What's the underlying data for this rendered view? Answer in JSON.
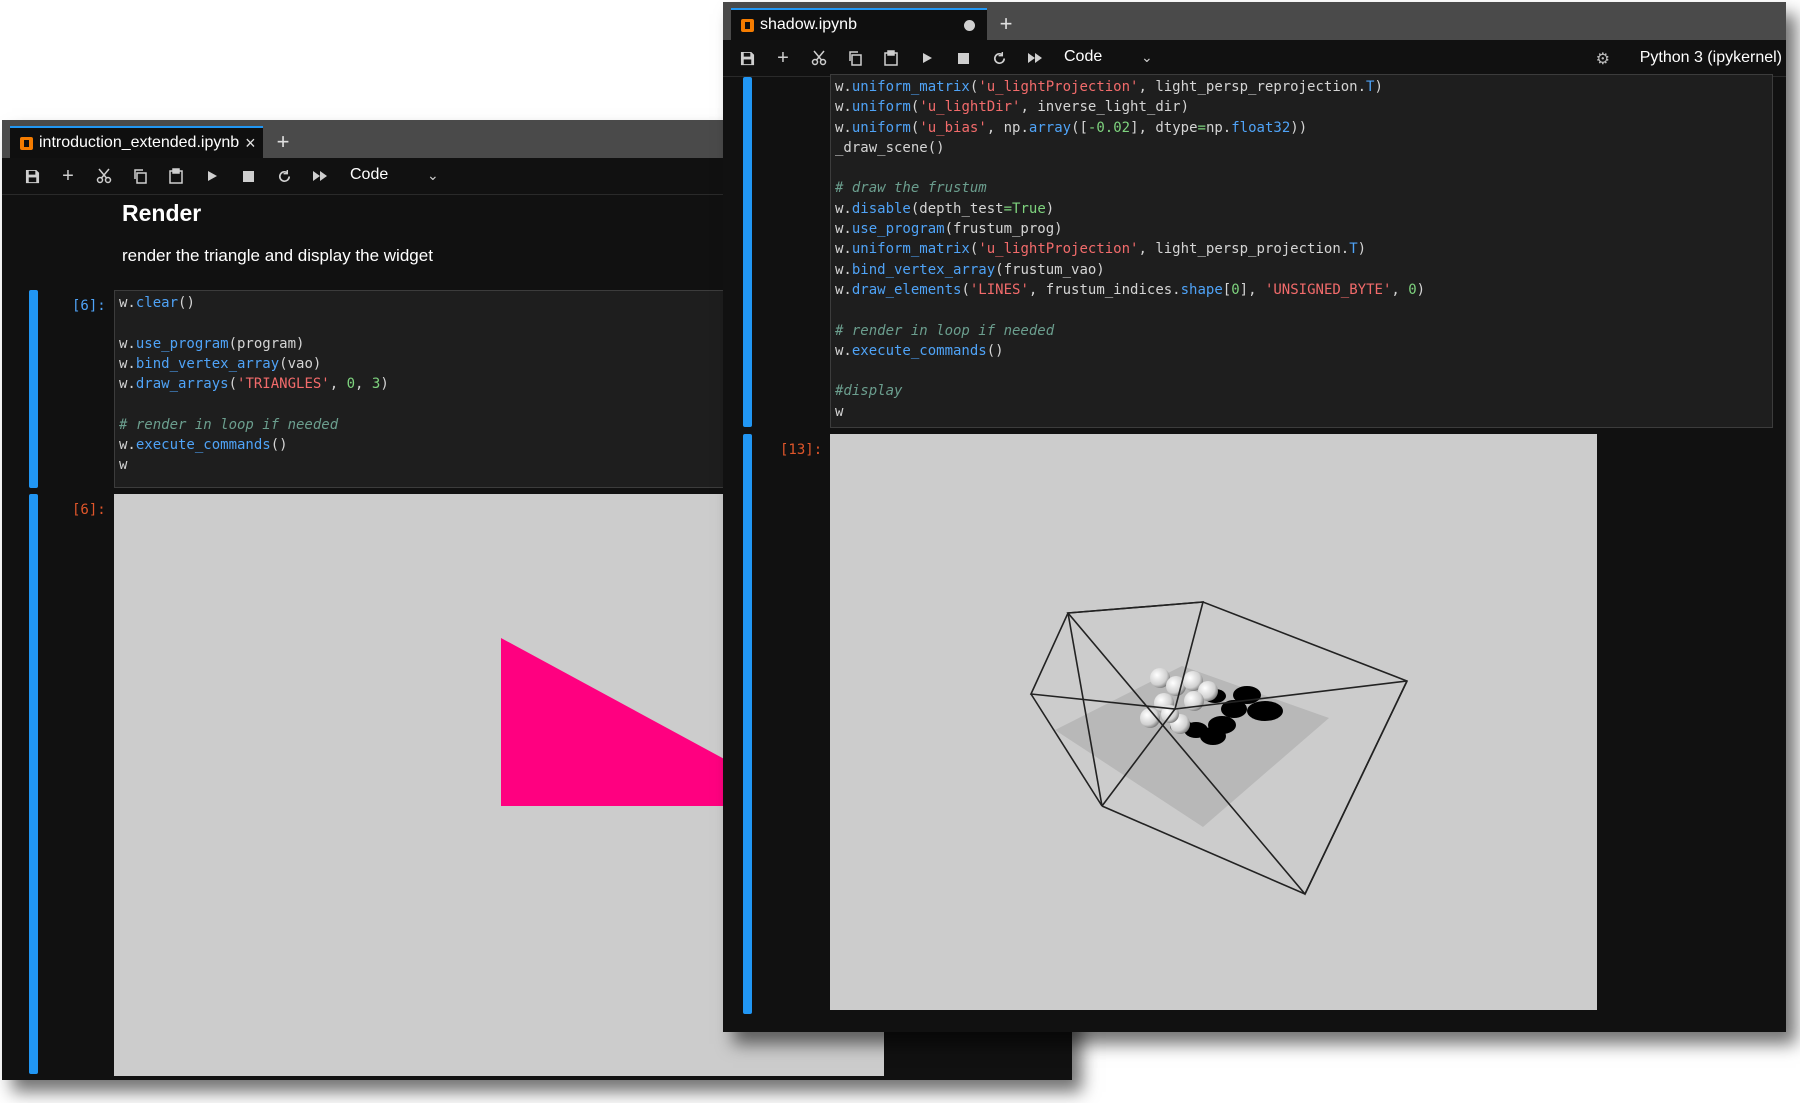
{
  "windowA": {
    "tab_label": "introduction_extended.ipynb",
    "tab_close": "×",
    "new_tab": "+",
    "toolbar": {
      "cell_type": "Code",
      "icons": [
        "save-icon",
        "add-cell-icon",
        "cut-icon",
        "copy-icon",
        "paste-icon",
        "run-icon",
        "stop-icon",
        "restart-icon",
        "fast-forward-icon"
      ]
    },
    "markdown": {
      "heading": "Render",
      "text": "render the triangle and display the widget"
    },
    "input_prompt": "[6]:",
    "output_prompt": "[6]:",
    "code_lines": [
      [
        [
          "w.",
          ""
        ],
        [
          "clear",
          "fn"
        ],
        [
          "()",
          ""
        ]
      ],
      [],
      [
        [
          "w.",
          ""
        ],
        [
          "use_program",
          "fn"
        ],
        [
          "(program)",
          ""
        ]
      ],
      [
        [
          "w.",
          ""
        ],
        [
          "bind_vertex_array",
          "fn"
        ],
        [
          "(vao)",
          ""
        ]
      ],
      [
        [
          "w.",
          ""
        ],
        [
          "draw_arrays",
          "fn"
        ],
        [
          "(",
          ""
        ],
        [
          "'TRIANGLES'",
          "str"
        ],
        [
          ", ",
          ""
        ],
        [
          "0",
          "num"
        ],
        [
          ", ",
          ""
        ],
        [
          "3",
          "num"
        ],
        [
          ")",
          ""
        ]
      ],
      [],
      [
        [
          "# render in loop if needed",
          "com"
        ]
      ],
      [
        [
          "w.",
          ""
        ],
        [
          "execute_commands",
          "fn"
        ],
        [
          "()",
          ""
        ]
      ],
      [
        [
          "w",
          ""
        ]
      ]
    ],
    "triangle_color": "#ff0080"
  },
  "windowB": {
    "tab_label": "shadow.ipynb",
    "new_tab": "+",
    "toolbar": {
      "cell_type": "Code",
      "kernel": "Python 3 (ipykernel)",
      "icons": [
        "save-icon",
        "add-cell-icon",
        "cut-icon",
        "copy-icon",
        "paste-icon",
        "run-icon",
        "stop-icon",
        "restart-icon",
        "fast-forward-icon",
        "bug-icon"
      ]
    },
    "output_prompt": "[13]:",
    "code_lines": [
      [
        [
          "w.",
          ""
        ],
        [
          "uniform_matrix",
          "fn"
        ],
        [
          "(",
          ""
        ],
        [
          "'u_lightProjection'",
          "str"
        ],
        [
          ", light_persp_reprojection.",
          ""
        ],
        [
          "T",
          "fn"
        ],
        [
          ")",
          ""
        ]
      ],
      [
        [
          "w.",
          ""
        ],
        [
          "uniform",
          "fn"
        ],
        [
          "(",
          ""
        ],
        [
          "'u_lightDir'",
          "str"
        ],
        [
          ", inverse_light_dir)",
          ""
        ]
      ],
      [
        [
          "w.",
          ""
        ],
        [
          "uniform",
          "fn"
        ],
        [
          "(",
          ""
        ],
        [
          "'u_bias'",
          "str"
        ],
        [
          ", np.",
          ""
        ],
        [
          "array",
          "fn"
        ],
        [
          "([",
          ""
        ],
        [
          "-0.02",
          "num"
        ],
        [
          "], dtype",
          ""
        ],
        [
          "=",
          "kw"
        ],
        [
          "np.",
          ""
        ],
        [
          "float32",
          "fn"
        ],
        [
          "))",
          ""
        ]
      ],
      [
        [
          "_draw_scene()",
          ""
        ]
      ],
      [],
      [
        [
          "# draw the frustum",
          "com"
        ]
      ],
      [
        [
          "w.",
          ""
        ],
        [
          "disable",
          "fn"
        ],
        [
          "(depth_test",
          ""
        ],
        [
          "=",
          "kw"
        ],
        [
          "True",
          "kw"
        ],
        [
          ")",
          ""
        ]
      ],
      [
        [
          "w.",
          ""
        ],
        [
          "use_program",
          "fn"
        ],
        [
          "(frustum_prog)",
          ""
        ]
      ],
      [
        [
          "w.",
          ""
        ],
        [
          "uniform_matrix",
          "fn"
        ],
        [
          "(",
          ""
        ],
        [
          "'u_lightProjection'",
          "str"
        ],
        [
          ", light_persp_projection.",
          ""
        ],
        [
          "T",
          "fn"
        ],
        [
          ")",
          ""
        ]
      ],
      [
        [
          "w.",
          ""
        ],
        [
          "bind_vertex_array",
          "fn"
        ],
        [
          "(frustum_vao)",
          ""
        ]
      ],
      [
        [
          "w.",
          ""
        ],
        [
          "draw_elements",
          "fn"
        ],
        [
          "(",
          ""
        ],
        [
          "'LINES'",
          "str"
        ],
        [
          ", frustum_indices.",
          ""
        ],
        [
          "shape",
          "fn"
        ],
        [
          "[",
          ""
        ],
        [
          "0",
          "num"
        ],
        [
          "], ",
          ""
        ],
        [
          "'UNSIGNED_BYTE'",
          "str"
        ],
        [
          ", ",
          ""
        ],
        [
          "0",
          "num"
        ],
        [
          ")",
          ""
        ]
      ],
      [],
      [
        [
          "# render in loop if needed",
          "com"
        ]
      ],
      [
        [
          "w.",
          ""
        ],
        [
          "execute_commands",
          "fn"
        ],
        [
          "()",
          ""
        ]
      ],
      [],
      [
        [
          "#display",
          "com"
        ]
      ],
      [
        [
          "w",
          ""
        ]
      ]
    ]
  }
}
